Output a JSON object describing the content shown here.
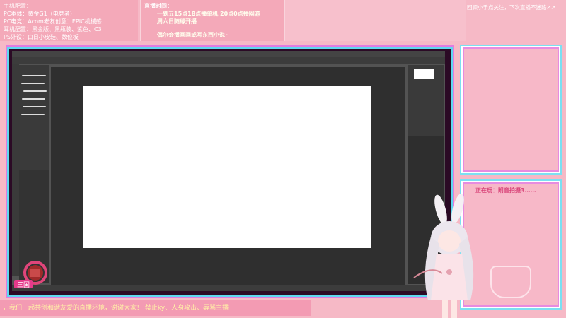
{
  "header": {
    "info_lines": [
      "主机配置：",
      "PC本体：黄金G1（电竞者）",
      "PC电竞：Acom老友创意：EPIC机械感",
      "耳机配置：黑金版、黑瓶装、紫色、C3",
      "PS外设：白日小皮鞋、数位板"
    ],
    "schedule_title": "直播时间：",
    "schedule_lines": [
      "一到五15点18点播单机 20点0点播网游",
      "周六日随缘开播"
    ],
    "schedule_note": "偶尔会播画画或写东西小说~",
    "top_ticker": "回顾小手点关注，下次直播不迷路↗↗"
  },
  "side": {
    "now_playing": "正在玩：附音拍摄3……"
  },
  "footer": {
    "ticker": "，我们一起共创和谐友爱的直播环境，谢谢大家！   禁止ky、人身攻击、辱骂主播"
  },
  "logo": {
    "text": "三国"
  },
  "colors": {
    "pink_bg": "#f6b9c6",
    "frame_cyan": "#5fd8f0",
    "frame_magenta": "#e07ce0",
    "ps_gray": "#535353",
    "canvas_white": "#ffffff"
  }
}
